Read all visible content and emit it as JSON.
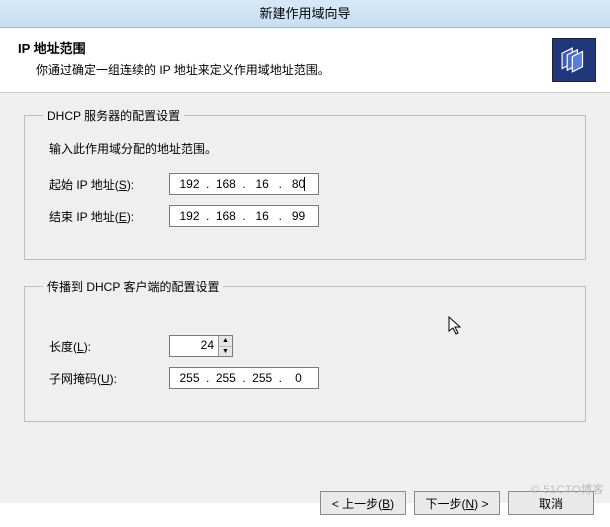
{
  "window": {
    "title": "新建作用域向导"
  },
  "header": {
    "title": "IP 地址范围",
    "subtitle": "你通过确定一组连续的 IP 地址来定义作用域地址范围。"
  },
  "group_server": {
    "legend": "DHCP 服务器的配置设置",
    "hint": "输入此作用域分配的地址范围。",
    "start_label_pre": "起始 IP 地址(",
    "start_label_key": "S",
    "start_label_post": "):",
    "end_label_pre": "结束 IP 地址(",
    "end_label_key": "E",
    "end_label_post": "):",
    "start_ip": {
      "a": "192",
      "b": "168",
      "c": "16",
      "d": "80"
    },
    "end_ip": {
      "a": "192",
      "b": "168",
      "c": "16",
      "d": "99"
    }
  },
  "group_client": {
    "legend": "传播到 DHCP 客户端的配置设置",
    "length_label_pre": "长度(",
    "length_label_key": "L",
    "length_label_post": "):",
    "length_value": "24",
    "mask_label_pre": "子网掩码(",
    "mask_label_key": "U",
    "mask_label_post": "):",
    "mask": {
      "a": "255",
      "b": "255",
      "c": "255",
      "d": "0"
    }
  },
  "buttons": {
    "back_pre": "< 上一步(",
    "back_key": "B",
    "back_post": ")",
    "next_pre": "下一步(",
    "next_key": "N",
    "next_post": ") >",
    "cancel": "取消"
  },
  "watermark": "© 51CTO博客"
}
